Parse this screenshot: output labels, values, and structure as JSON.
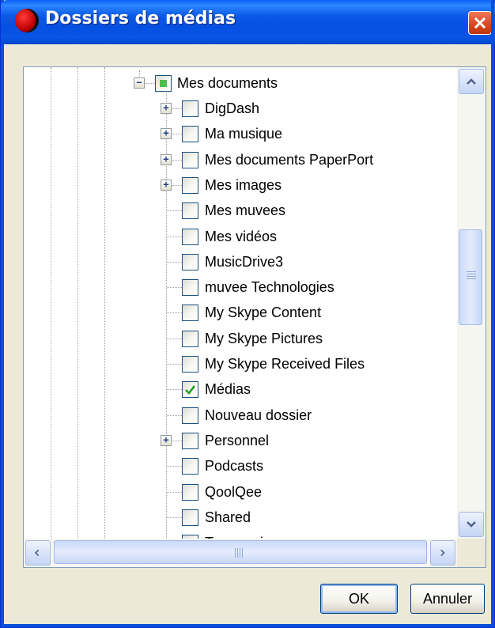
{
  "window": {
    "title": "Dossiers de médias",
    "icon": "red-circle-icon",
    "close_icon": "close-x-icon"
  },
  "tree": {
    "parent": {
      "label": "Mes documents",
      "state": "partial",
      "expander": "−"
    },
    "items": [
      {
        "label": "DigDash",
        "expandable": true,
        "checked": false
      },
      {
        "label": "Ma musique",
        "expandable": true,
        "checked": false
      },
      {
        "label": "Mes documents PaperPort",
        "expandable": true,
        "checked": false
      },
      {
        "label": "Mes images",
        "expandable": true,
        "checked": false
      },
      {
        "label": "Mes muvees",
        "expandable": false,
        "checked": false
      },
      {
        "label": "Mes vidéos",
        "expandable": false,
        "checked": false
      },
      {
        "label": "MusicDrive3",
        "expandable": false,
        "checked": false
      },
      {
        "label": "muvee Technologies",
        "expandable": false,
        "checked": false
      },
      {
        "label": "My Skype Content",
        "expandable": false,
        "checked": false
      },
      {
        "label": "My Skype Pictures",
        "expandable": false,
        "checked": false
      },
      {
        "label": "My Skype Received Files",
        "expandable": false,
        "checked": false
      },
      {
        "label": "Médias",
        "expandable": false,
        "checked": true
      },
      {
        "label": "Nouveau dossier",
        "expandable": false,
        "checked": false
      },
      {
        "label": "Personnel",
        "expandable": true,
        "checked": false
      },
      {
        "label": "Podcasts",
        "expandable": false,
        "checked": false
      },
      {
        "label": "QoolQee",
        "expandable": false,
        "checked": false
      },
      {
        "label": "Shared",
        "expandable": false,
        "checked": false
      },
      {
        "label": "Temporaire",
        "expandable": false,
        "checked": false
      }
    ]
  },
  "scroll": {
    "vertical_position": 0.35,
    "horizontal_position": 0.0
  },
  "buttons": {
    "ok": "OK",
    "cancel": "Annuler"
  },
  "colors": {
    "titlebar": "#0550e0",
    "check": "#21a121",
    "partial": "#4dbd4b",
    "close": "#d7441f"
  }
}
